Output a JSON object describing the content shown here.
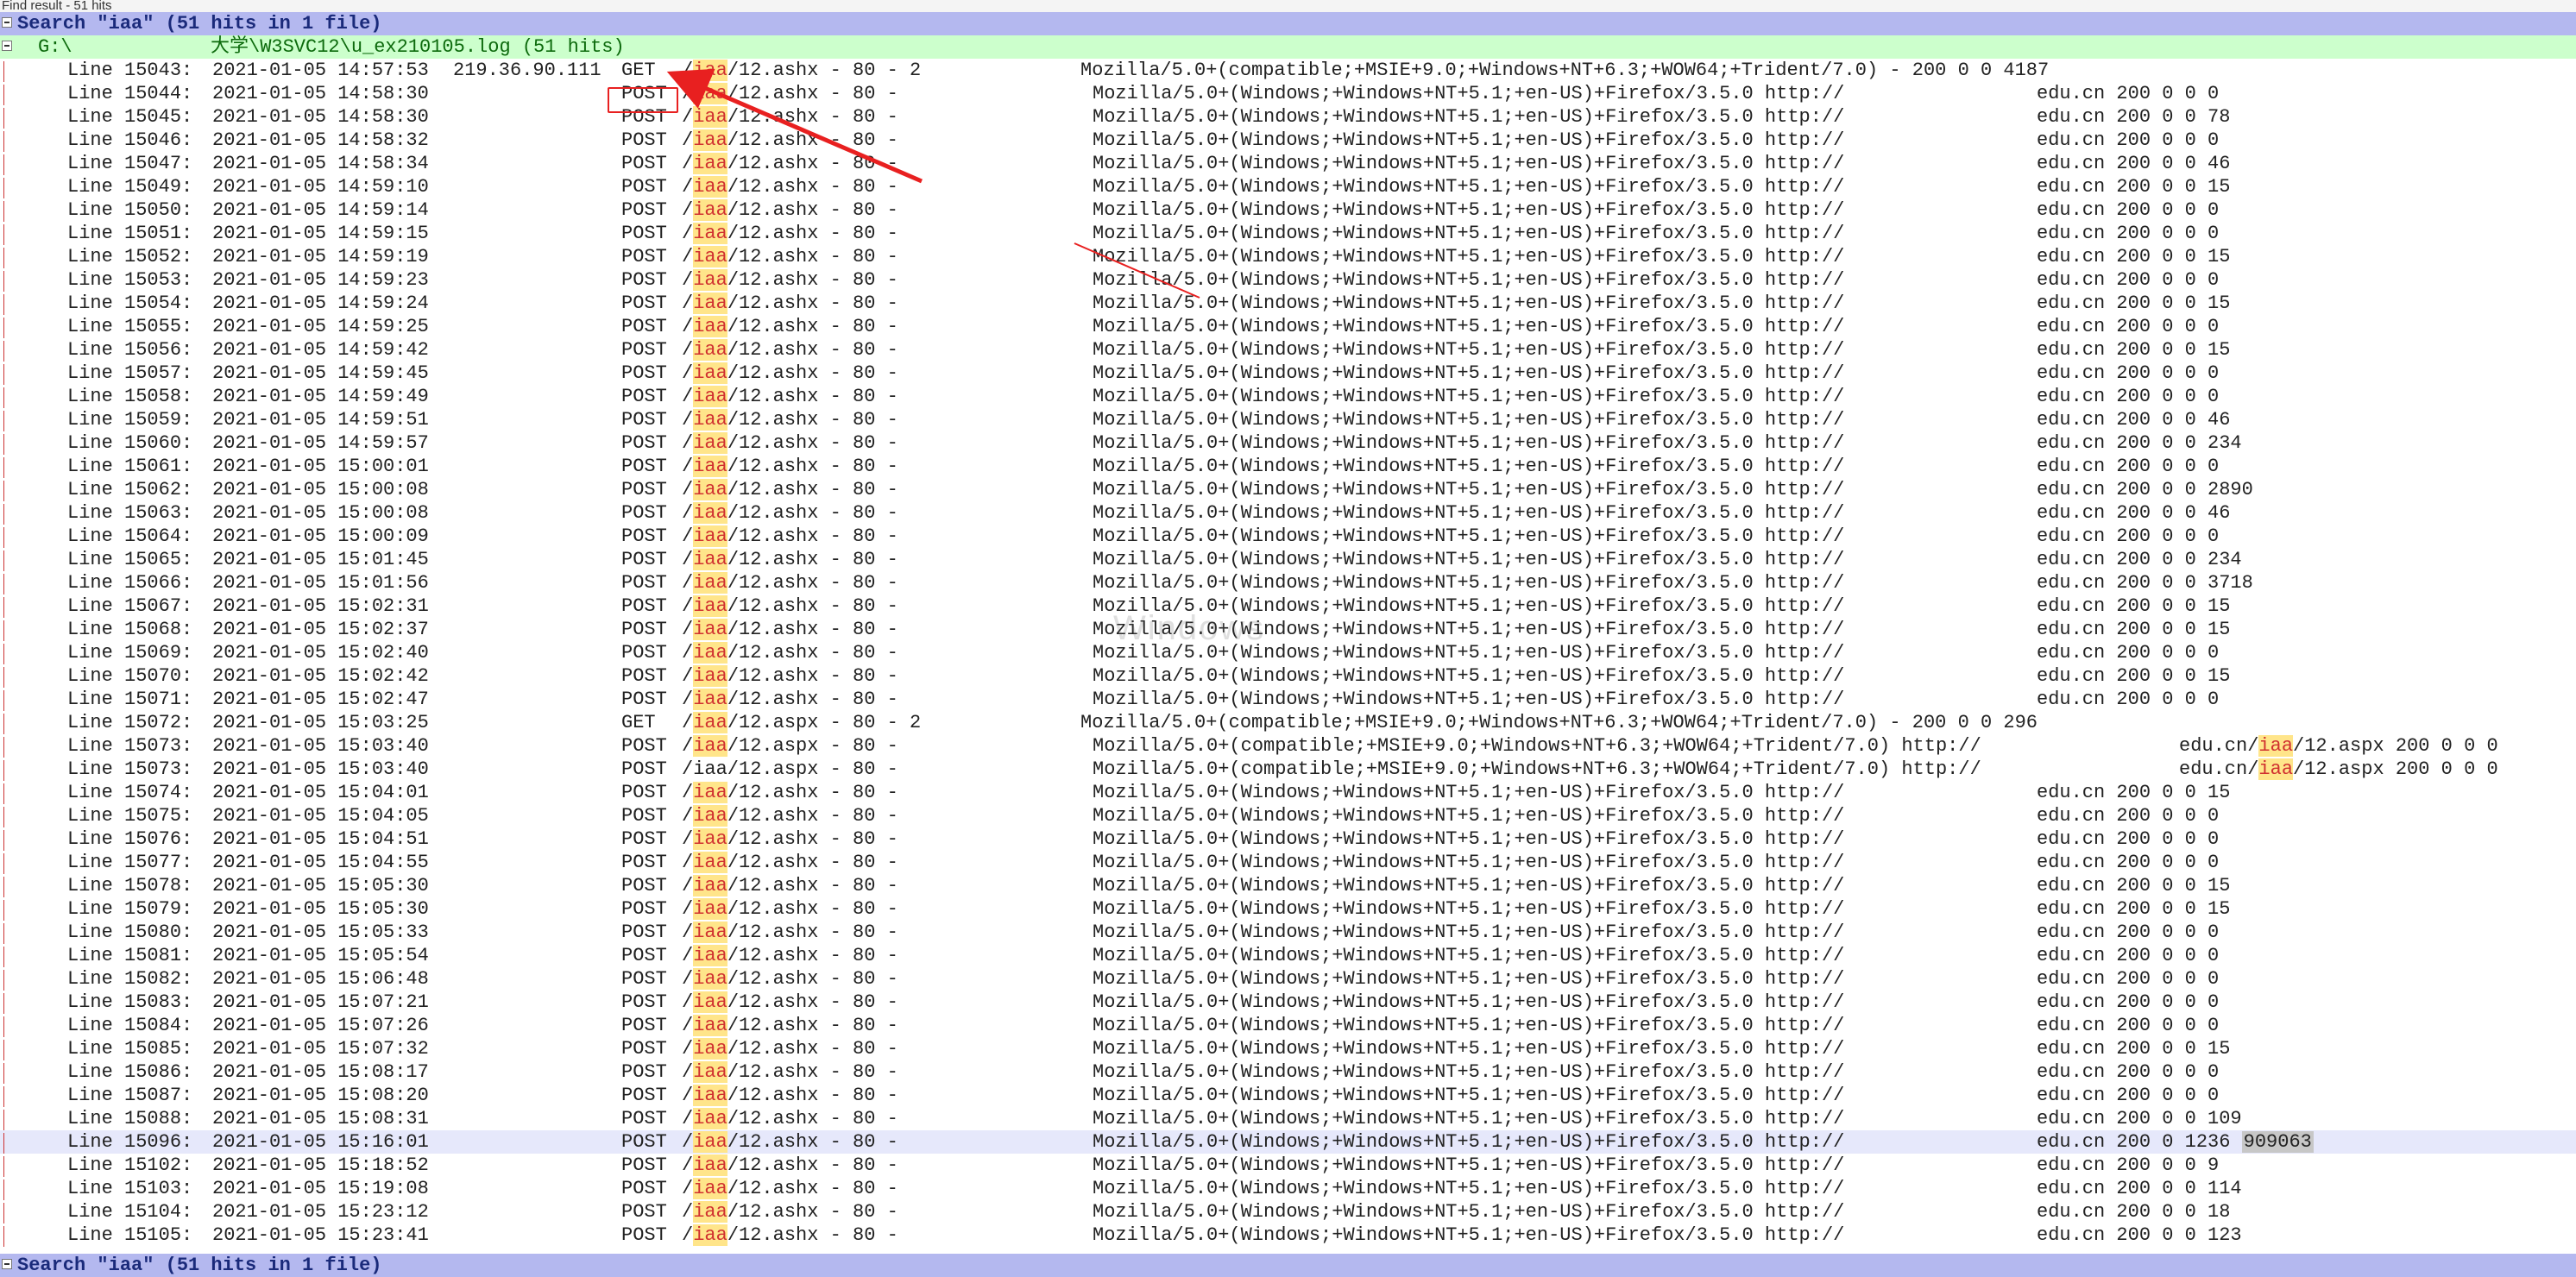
{
  "panel_title": "Find result - 51 hits",
  "search_header": "Search \"iaa\" (51 hits in 1 file)",
  "file_header_prefix": "G:\\",
  "file_header_path": "大学\\W3SVC12\\u_ex210105.log (51 hits)",
  "watermark": "Windows",
  "highlighted_line": "Line 15096:",
  "highlighted_value": "909063",
  "rows": [
    {
      "line": "Line 15043:",
      "ts": "2021-01-05 14:57:53",
      "ip": "219.36.90.111",
      "method": "GET",
      "hit": "iaa",
      "path": "/12.ashx - 80 - 2",
      "ua": "Mozilla/5.0+(compatible;+MSIE+9.0;+Windows+NT+6.3;+WOW64;+Trident/7.0) - 200 0 0 4187",
      "host": "",
      "tail": ""
    },
    {
      "line": "Line 15044:",
      "ts": "2021-01-05 14:58:30",
      "ip": "",
      "method": "POST",
      "hit": "iaa",
      "path": "/12.ashx - 80 -",
      "ua": "Mozilla/5.0+(Windows;+Windows+NT+5.1;+en-US)+Firefox/3.5.0 http://",
      "host": "edu.cn",
      "tail": "200 0 0 0"
    },
    {
      "line": "Line 15045:",
      "ts": "2021-01-05 14:58:30",
      "ip": "",
      "method": "POST",
      "hit": "iaa",
      "path": "/12.ashx - 80 -",
      "ua": "Mozilla/5.0+(Windows;+Windows+NT+5.1;+en-US)+Firefox/3.5.0 http://",
      "host": "edu.cn",
      "tail": "200 0 0 78"
    },
    {
      "line": "Line 15046:",
      "ts": "2021-01-05 14:58:32",
      "ip": "",
      "method": "POST",
      "hit": "iaa",
      "path": "/12.ashx - 80 -",
      "ua": "Mozilla/5.0+(Windows;+Windows+NT+5.1;+en-US)+Firefox/3.5.0 http://",
      "host": "edu.cn",
      "tail": "200 0 0 0"
    },
    {
      "line": "Line 15047:",
      "ts": "2021-01-05 14:58:34",
      "ip": "",
      "method": "POST",
      "hit": "iaa",
      "path": "/12.ashx - 80 -",
      "ua": "Mozilla/5.0+(Windows;+Windows+NT+5.1;+en-US)+Firefox/3.5.0 http://",
      "host": "edu.cn",
      "tail": "200 0 0 46"
    },
    {
      "line": "Line 15049:",
      "ts": "2021-01-05 14:59:10",
      "ip": "",
      "method": "POST",
      "hit": "iaa",
      "path": "/12.ashx - 80 -",
      "ua": "Mozilla/5.0+(Windows;+Windows+NT+5.1;+en-US)+Firefox/3.5.0 http://",
      "host": "edu.cn",
      "tail": "200 0 0 15"
    },
    {
      "line": "Line 15050:",
      "ts": "2021-01-05 14:59:14",
      "ip": "",
      "method": "POST",
      "hit": "iaa",
      "path": "/12.ashx - 80 -",
      "ua": "Mozilla/5.0+(Windows;+Windows+NT+5.1;+en-US)+Firefox/3.5.0 http://",
      "host": "edu.cn",
      "tail": "200 0 0 0"
    },
    {
      "line": "Line 15051:",
      "ts": "2021-01-05 14:59:15",
      "ip": "",
      "method": "POST",
      "hit": "iaa",
      "path": "/12.ashx - 80 -",
      "ua": "Mozilla/5.0+(Windows;+Windows+NT+5.1;+en-US)+Firefox/3.5.0 http://",
      "host": "edu.cn",
      "tail": "200 0 0 0"
    },
    {
      "line": "Line 15052:",
      "ts": "2021-01-05 14:59:19",
      "ip": "",
      "method": "POST",
      "hit": "iaa",
      "path": "/12.ashx - 80 -",
      "ua": "Mozilla/5.0+(Windows;+Windows+NT+5.1;+en-US)+Firefox/3.5.0 http://",
      "host": "edu.cn",
      "tail": "200 0 0 15"
    },
    {
      "line": "Line 15053:",
      "ts": "2021-01-05 14:59:23",
      "ip": "",
      "method": "POST",
      "hit": "iaa",
      "path": "/12.ashx - 80 -",
      "ua": "Mozilla/5.0+(Windows;+Windows+NT+5.1;+en-US)+Firefox/3.5.0 http://",
      "host": "edu.cn",
      "tail": "200 0 0 0"
    },
    {
      "line": "Line 15054:",
      "ts": "2021-01-05 14:59:24",
      "ip": "",
      "method": "POST",
      "hit": "iaa",
      "path": "/12.ashx - 80 -",
      "ua": "Mozilla/5.0+(Windows;+Windows+NT+5.1;+en-US)+Firefox/3.5.0 http://",
      "host": "edu.cn",
      "tail": "200 0 0 15"
    },
    {
      "line": "Line 15055:",
      "ts": "2021-01-05 14:59:25",
      "ip": "",
      "method": "POST",
      "hit": "iaa",
      "path": "/12.ashx - 80 -",
      "ua": "Mozilla/5.0+(Windows;+Windows+NT+5.1;+en-US)+Firefox/3.5.0 http://",
      "host": "edu.cn",
      "tail": "200 0 0 0"
    },
    {
      "line": "Line 15056:",
      "ts": "2021-01-05 14:59:42",
      "ip": "",
      "method": "POST",
      "hit": "iaa",
      "path": "/12.ashx - 80 -",
      "ua": "Mozilla/5.0+(Windows;+Windows+NT+5.1;+en-US)+Firefox/3.5.0 http://",
      "host": "edu.cn",
      "tail": "200 0 0 15"
    },
    {
      "line": "Line 15057:",
      "ts": "2021-01-05 14:59:45",
      "ip": "",
      "method": "POST",
      "hit": "iaa",
      "path": "/12.ashx - 80 -",
      "ua": "Mozilla/5.0+(Windows;+Windows+NT+5.1;+en-US)+Firefox/3.5.0 http://",
      "host": "edu.cn",
      "tail": "200 0 0 0"
    },
    {
      "line": "Line 15058:",
      "ts": "2021-01-05 14:59:49",
      "ip": "",
      "method": "POST",
      "hit": "iaa",
      "path": "/12.ashx - 80 -",
      "ua": "Mozilla/5.0+(Windows;+Windows+NT+5.1;+en-US)+Firefox/3.5.0 http://",
      "host": "edu.cn",
      "tail": "200 0 0 0"
    },
    {
      "line": "Line 15059:",
      "ts": "2021-01-05 14:59:51",
      "ip": "",
      "method": "POST",
      "hit": "iaa",
      "path": "/12.ashx - 80 -",
      "ua": "Mozilla/5.0+(Windows;+Windows+NT+5.1;+en-US)+Firefox/3.5.0 http://",
      "host": "edu.cn",
      "tail": "200 0 0 46"
    },
    {
      "line": "Line 15060:",
      "ts": "2021-01-05 14:59:57",
      "ip": "",
      "method": "POST",
      "hit": "iaa",
      "path": "/12.ashx - 80 -",
      "ua": "Mozilla/5.0+(Windows;+Windows+NT+5.1;+en-US)+Firefox/3.5.0 http://",
      "host": "edu.cn",
      "tail": "200 0 0 234"
    },
    {
      "line": "Line 15061:",
      "ts": "2021-01-05 15:00:01",
      "ip": "",
      "method": "POST",
      "hit": "iaa",
      "path": "/12.ashx - 80 -",
      "ua": "Mozilla/5.0+(Windows;+Windows+NT+5.1;+en-US)+Firefox/3.5.0 http://",
      "host": "edu.cn",
      "tail": "200 0 0 0"
    },
    {
      "line": "Line 15062:",
      "ts": "2021-01-05 15:00:08",
      "ip": "",
      "method": "POST",
      "hit": "iaa",
      "path": "/12.ashx - 80 -",
      "ua": "Mozilla/5.0+(Windows;+Windows+NT+5.1;+en-US)+Firefox/3.5.0 http://",
      "host": "edu.cn",
      "tail": "200 0 0 2890"
    },
    {
      "line": "Line 15063:",
      "ts": "2021-01-05 15:00:08",
      "ip": "",
      "method": "POST",
      "hit": "iaa",
      "path": "/12.ashx - 80 -",
      "ua": "Mozilla/5.0+(Windows;+Windows+NT+5.1;+en-US)+Firefox/3.5.0 http://",
      "host": "edu.cn",
      "tail": "200 0 0 46"
    },
    {
      "line": "Line 15064:",
      "ts": "2021-01-05 15:00:09",
      "ip": "",
      "method": "POST",
      "hit": "iaa",
      "path": "/12.ashx - 80 -",
      "ua": "Mozilla/5.0+(Windows;+Windows+NT+5.1;+en-US)+Firefox/3.5.0 http://",
      "host": "edu.cn",
      "tail": "200 0 0 0"
    },
    {
      "line": "Line 15065:",
      "ts": "2021-01-05 15:01:45",
      "ip": "",
      "method": "POST",
      "hit": "iaa",
      "path": "/12.ashx - 80 -",
      "ua": "Mozilla/5.0+(Windows;+Windows+NT+5.1;+en-US)+Firefox/3.5.0 http://",
      "host": "edu.cn",
      "tail": "200 0 0 234"
    },
    {
      "line": "Line 15066:",
      "ts": "2021-01-05 15:01:56",
      "ip": "",
      "method": "POST",
      "hit": "iaa",
      "path": "/12.ashx - 80 -",
      "ua": "Mozilla/5.0+(Windows;+Windows+NT+5.1;+en-US)+Firefox/3.5.0 http://",
      "host": "edu.cn",
      "tail": "200 0 0 3718"
    },
    {
      "line": "Line 15067:",
      "ts": "2021-01-05 15:02:31",
      "ip": "",
      "method": "POST",
      "hit": "iaa",
      "path": "/12.ashx - 80 -",
      "ua": "Mozilla/5.0+(Windows;+Windows+NT+5.1;+en-US)+Firefox/3.5.0 http://",
      "host": "edu.cn",
      "tail": "200 0 0 15"
    },
    {
      "line": "Line 15068:",
      "ts": "2021-01-05 15:02:37",
      "ip": "",
      "method": "POST",
      "hit": "iaa",
      "path": "/12.ashx - 80 -",
      "ua": "Mozilla/5.0+(Windows;+Windows+NT+5.1;+en-US)+Firefox/3.5.0 http://",
      "host": "edu.cn",
      "tail": "200 0 0 15"
    },
    {
      "line": "Line 15069:",
      "ts": "2021-01-05 15:02:40",
      "ip": "",
      "method": "POST",
      "hit": "iaa",
      "path": "/12.ashx - 80 -",
      "ua": "Mozilla/5.0+(Windows;+Windows+NT+5.1;+en-US)+Firefox/3.5.0 http://",
      "host": "edu.cn",
      "tail": "200 0 0 0"
    },
    {
      "line": "Line 15070:",
      "ts": "2021-01-05 15:02:42",
      "ip": "",
      "method": "POST",
      "hit": "iaa",
      "path": "/12.ashx - 80 -",
      "ua": "Mozilla/5.0+(Windows;+Windows+NT+5.1;+en-US)+Firefox/3.5.0 http://",
      "host": "edu.cn",
      "tail": "200 0 0 15"
    },
    {
      "line": "Line 15071:",
      "ts": "2021-01-05 15:02:47",
      "ip": "",
      "method": "POST",
      "hit": "iaa",
      "path": "/12.ashx - 80 -",
      "ua": "Mozilla/5.0+(Windows;+Windows+NT+5.1;+en-US)+Firefox/3.5.0 http://",
      "host": "edu.cn",
      "tail": "200 0 0 0"
    },
    {
      "line": "Line 15072:",
      "ts": "2021-01-05 15:03:25",
      "ip": "",
      "method": "GET",
      "hit": "iaa",
      "path": "/12.aspx - 80 - 2",
      "ua": "Mozilla/5.0+(compatible;+MSIE+9.0;+Windows+NT+6.3;+WOW64;+Trident/7.0) - 200 0 0 296",
      "host": "",
      "tail": ""
    },
    {
      "line": "Line 15073:",
      "ts": "2021-01-05 15:03:40",
      "ip": "",
      "method": "POST",
      "hit": "iaa",
      "path": "/12.aspx - 80 -",
      "ua": "Mozilla/5.0+(compatible;+MSIE+9.0;+Windows+NT+6.3;+WOW64;+Trident/7.0) http://",
      "host": "edu.cn/",
      "hit2": "iaa",
      "tail": "/12.aspx 200 0 0 0",
      "wide": true
    },
    {
      "line": "Line 15073:",
      "ts": "2021-01-05 15:03:40",
      "ip": "",
      "method": "POST",
      "hit": "",
      "path": "/iaa/12.aspx - 80 -",
      "ua": "Mozilla/5.0+(compatible;+MSIE+9.0;+Windows+NT+6.3;+WOW64;+Trident/7.0) http://",
      "host": "edu.cn/",
      "hit2": "iaa",
      "tail": "/12.aspx 200 0 0 0",
      "wide": true
    },
    {
      "line": "Line 15074:",
      "ts": "2021-01-05 15:04:01",
      "ip": "",
      "method": "POST",
      "hit": "iaa",
      "path": "/12.ashx - 80 -",
      "ua": "Mozilla/5.0+(Windows;+Windows+NT+5.1;+en-US)+Firefox/3.5.0 http://",
      "host": "edu.cn",
      "tail": "200 0 0 15"
    },
    {
      "line": "Line 15075:",
      "ts": "2021-01-05 15:04:05",
      "ip": "",
      "method": "POST",
      "hit": "iaa",
      "path": "/12.ashx - 80 -",
      "ua": "Mozilla/5.0+(Windows;+Windows+NT+5.1;+en-US)+Firefox/3.5.0 http://",
      "host": "edu.cn",
      "tail": "200 0 0 0"
    },
    {
      "line": "Line 15076:",
      "ts": "2021-01-05 15:04:51",
      "ip": "",
      "method": "POST",
      "hit": "iaa",
      "path": "/12.ashx - 80 -",
      "ua": "Mozilla/5.0+(Windows;+Windows+NT+5.1;+en-US)+Firefox/3.5.0 http://",
      "host": "edu.cn",
      "tail": "200 0 0 0"
    },
    {
      "line": "Line 15077:",
      "ts": "2021-01-05 15:04:55",
      "ip": "",
      "method": "POST",
      "hit": "iaa",
      "path": "/12.ashx - 80 -",
      "ua": "Mozilla/5.0+(Windows;+Windows+NT+5.1;+en-US)+Firefox/3.5.0 http://",
      "host": "edu.cn",
      "tail": "200 0 0 0"
    },
    {
      "line": "Line 15078:",
      "ts": "2021-01-05 15:05:30",
      "ip": "",
      "method": "POST",
      "hit": "iaa",
      "path": "/12.ashx - 80 -",
      "ua": "Mozilla/5.0+(Windows;+Windows+NT+5.1;+en-US)+Firefox/3.5.0 http://",
      "host": "edu.cn",
      "tail": "200 0 0 15"
    },
    {
      "line": "Line 15079:",
      "ts": "2021-01-05 15:05:30",
      "ip": "",
      "method": "POST",
      "hit": "iaa",
      "path": "/12.ashx - 80 -",
      "ua": "Mozilla/5.0+(Windows;+Windows+NT+5.1;+en-US)+Firefox/3.5.0 http://",
      "host": "edu.cn",
      "tail": "200 0 0 15"
    },
    {
      "line": "Line 15080:",
      "ts": "2021-01-05 15:05:33",
      "ip": "",
      "method": "POST",
      "hit": "iaa",
      "path": "/12.ashx - 80 -",
      "ua": "Mozilla/5.0+(Windows;+Windows+NT+5.1;+en-US)+Firefox/3.5.0 http://",
      "host": "edu.cn",
      "tail": "200 0 0 0"
    },
    {
      "line": "Line 15081:",
      "ts": "2021-01-05 15:05:54",
      "ip": "",
      "method": "POST",
      "hit": "iaa",
      "path": "/12.ashx - 80 -",
      "ua": "Mozilla/5.0+(Windows;+Windows+NT+5.1;+en-US)+Firefox/3.5.0 http://",
      "host": "edu.cn",
      "tail": "200 0 0 0"
    },
    {
      "line": "Line 15082:",
      "ts": "2021-01-05 15:06:48",
      "ip": "",
      "method": "POST",
      "hit": "iaa",
      "path": "/12.ashx - 80 -",
      "ua": "Mozilla/5.0+(Windows;+Windows+NT+5.1;+en-US)+Firefox/3.5.0 http://",
      "host": "edu.cn",
      "tail": "200 0 0 0"
    },
    {
      "line": "Line 15083:",
      "ts": "2021-01-05 15:07:21",
      "ip": "",
      "method": "POST",
      "hit": "iaa",
      "path": "/12.ashx - 80 -",
      "ua": "Mozilla/5.0+(Windows;+Windows+NT+5.1;+en-US)+Firefox/3.5.0 http://",
      "host": "edu.cn",
      "tail": "200 0 0 0"
    },
    {
      "line": "Line 15084:",
      "ts": "2021-01-05 15:07:26",
      "ip": "",
      "method": "POST",
      "hit": "iaa",
      "path": "/12.ashx - 80 -",
      "ua": "Mozilla/5.0+(Windows;+Windows+NT+5.1;+en-US)+Firefox/3.5.0 http://",
      "host": "edu.cn",
      "tail": "200 0 0 0"
    },
    {
      "line": "Line 15085:",
      "ts": "2021-01-05 15:07:32",
      "ip": "",
      "method": "POST",
      "hit": "iaa",
      "path": "/12.ashx - 80 -",
      "ua": "Mozilla/5.0+(Windows;+Windows+NT+5.1;+en-US)+Firefox/3.5.0 http://",
      "host": "edu.cn",
      "tail": "200 0 0 15"
    },
    {
      "line": "Line 15086:",
      "ts": "2021-01-05 15:08:17",
      "ip": "",
      "method": "POST",
      "hit": "iaa",
      "path": "/12.ashx - 80 -",
      "ua": "Mozilla/5.0+(Windows;+Windows+NT+5.1;+en-US)+Firefox/3.5.0 http://",
      "host": "edu.cn",
      "tail": "200 0 0 0"
    },
    {
      "line": "Line 15087:",
      "ts": "2021-01-05 15:08:20",
      "ip": "",
      "method": "POST",
      "hit": "iaa",
      "path": "/12.ashx - 80 -",
      "ua": "Mozilla/5.0+(Windows;+Windows+NT+5.1;+en-US)+Firefox/3.5.0 http://",
      "host": "edu.cn",
      "tail": "200 0 0 0"
    },
    {
      "line": "Line 15088:",
      "ts": "2021-01-05 15:08:31",
      "ip": "",
      "method": "POST",
      "hit": "iaa",
      "path": "/12.ashx - 80 -",
      "ua": "Mozilla/5.0+(Windows;+Windows+NT+5.1;+en-US)+Firefox/3.5.0 http://",
      "host": "edu.cn",
      "tail": "200 0 0 109"
    },
    {
      "line": "Line 15096:",
      "ts": "2021-01-05 15:16:01",
      "ip": "",
      "method": "POST",
      "hit": "iaa",
      "path": "/12.ashx - 80 -",
      "ua": "Mozilla/5.0+(Windows;+Windows+NT+5.1;+en-US)+Firefox/3.5.0 http://",
      "host": "edu.cn",
      "tail": "200 0 1236",
      "tail_hl": "909063",
      "selected": true
    },
    {
      "line": "Line 15102:",
      "ts": "2021-01-05 15:18:52",
      "ip": "",
      "method": "POST",
      "hit": "iaa",
      "path": "/12.ashx - 80 -",
      "ua": "Mozilla/5.0+(Windows;+Windows+NT+5.1;+en-US)+Firefox/3.5.0 http://",
      "host": "edu.cn",
      "tail": "200 0 0 9"
    },
    {
      "line": "Line 15103:",
      "ts": "2021-01-05 15:19:08",
      "ip": "",
      "method": "POST",
      "hit": "iaa",
      "path": "/12.ashx - 80 -",
      "ua": "Mozilla/5.0+(Windows;+Windows+NT+5.1;+en-US)+Firefox/3.5.0 http://",
      "host": "edu.cn",
      "tail": "200 0 0 114"
    },
    {
      "line": "Line 15104:",
      "ts": "2021-01-05 15:23:12",
      "ip": "",
      "method": "POST",
      "hit": "iaa",
      "path": "/12.ashx - 80 -",
      "ua": "Mozilla/5.0+(Windows;+Windows+NT+5.1;+en-US)+Firefox/3.5.0 http://",
      "host": "edu.cn",
      "tail": "200 0 0 18"
    },
    {
      "line": "Line 15105:",
      "ts": "2021-01-05 15:23:41",
      "ip": "",
      "method": "POST",
      "hit": "iaa",
      "path": "/12.ashx - 80 -",
      "ua": "Mozilla/5.0+(Windows;+Windows+NT+5.1;+en-US)+Firefox/3.5.0 http://",
      "host": "edu.cn",
      "tail": "200 0 0 123"
    }
  ],
  "footer_header": "Search \"iaa\" (51 hits in 1 file)",
  "colors": {
    "search_header_bg": "#b4b8ef",
    "file_header_bg": "#ccffcc",
    "hit_fg": "#d03030",
    "hit_bg": "#ffe58a",
    "annotation": "#e82020"
  }
}
